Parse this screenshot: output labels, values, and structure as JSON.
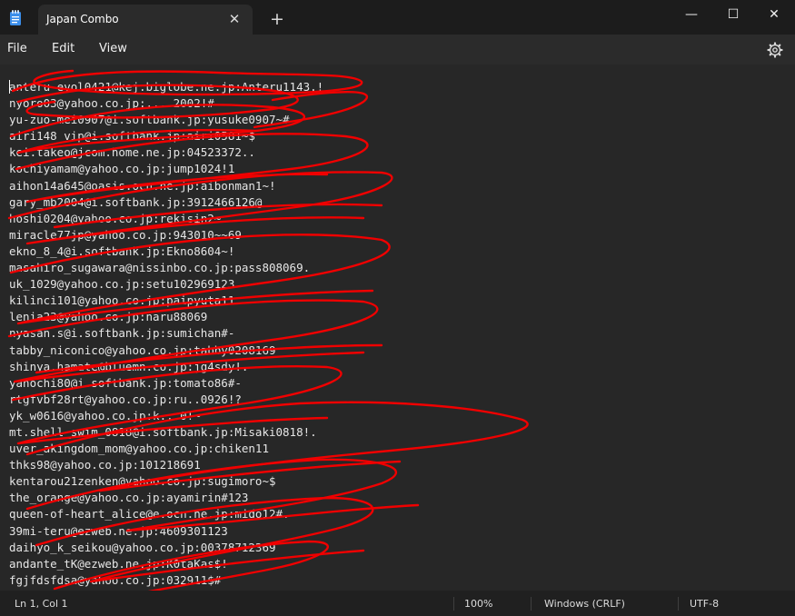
{
  "window": {
    "tab_title": "Japan Combo",
    "tab_close_glyph": "✕",
    "new_tab_glyph": "+",
    "minimize_glyph": "—",
    "maximize_glyph": "☐",
    "close_glyph": "✕",
    "app_icon": "notepad-icon"
  },
  "menu": {
    "file": "File",
    "edit": "Edit",
    "view": "View",
    "settings_icon": "gear-icon"
  },
  "document": {
    "lines": [
      "anteru-evol0421@kej.biglobe.ne.jp:Anteru1143.!",
      "nyoro03@yahoo.co.jp:....2002!#",
      "yu-zuo-mei0907@i.softbank.jp:yusuke0907~#",
      "airi148_vip@i.softbank.jp:airi0581~$",
      "kei.takeo@jcom.home.ne.jp:04523372..",
      "kochiyamam@yahoo.co.jp:jump1024!1",
      "aihon14a645@oasis.ocn.ne.jp:aibonman1~!",
      "gary_mb2004@i.softbank.jp:3912466126@",
      "hoshi0204@yahoo.co.jp:rekisin2~",
      "miracle77jp@yahoo.co.jp:943010~~69",
      "ekno_8_4@i.softbank.jp:Ekno8604~!",
      "masahiro_sugawara@nissinbo.co.jp:pass808069.",
      "uk_1029@yahoo.co.jp:setu102969123",
      "kilinci101@yahoo.co.jp:paipyuta11.",
      "lenia23@yahoo.co.jp:naru88069",
      "nyasan.s@i.softbank.jp:sumichan#-",
      "tabby_niconico@yahoo.co.jp:tabby0208169",
      "shinya.hamate@bluemn.co.jp:jg4sdy!.",
      "yanochi80@i.softbank.jp:tomato86#-",
      "rtgfvbf28rt@yahoo.co.jp:ru..0926!?",
      "yk_w0616@yahoo.co.jp:k...0!~",
      "mt.shell_swim_0818@i.softbank.jp:Misaki0818!.",
      "uver_akingdom_mom@yahoo.co.jp:chiken11",
      "thks98@yahoo.co.jp:101218691",
      "kentarou21zenken@yahoo.co.jp:sugimoro~$",
      "the_orange@yahoo.co.jp:ayamirin#123",
      "queen-of-heart_alice@e.ocn.ne.jp:mido12#.",
      "39mi-teru@ezweb.ne.jp:4609301123",
      "daihyo_k_seikou@yahoo.co.jp:00378712369",
      "andante_tK@ezweb.ne.jp:K0taKas$!",
      "fgjfdsfdsa@yahoo.co.jp:032911$#"
    ]
  },
  "status": {
    "position": "Ln 1, Col 1",
    "zoom": "100%",
    "line_ending": "Windows (CRLF)",
    "encoding": "UTF-8"
  },
  "colors": {
    "scribble": "#f00000",
    "background": "#272727",
    "chrome": "#1c1c1c"
  }
}
